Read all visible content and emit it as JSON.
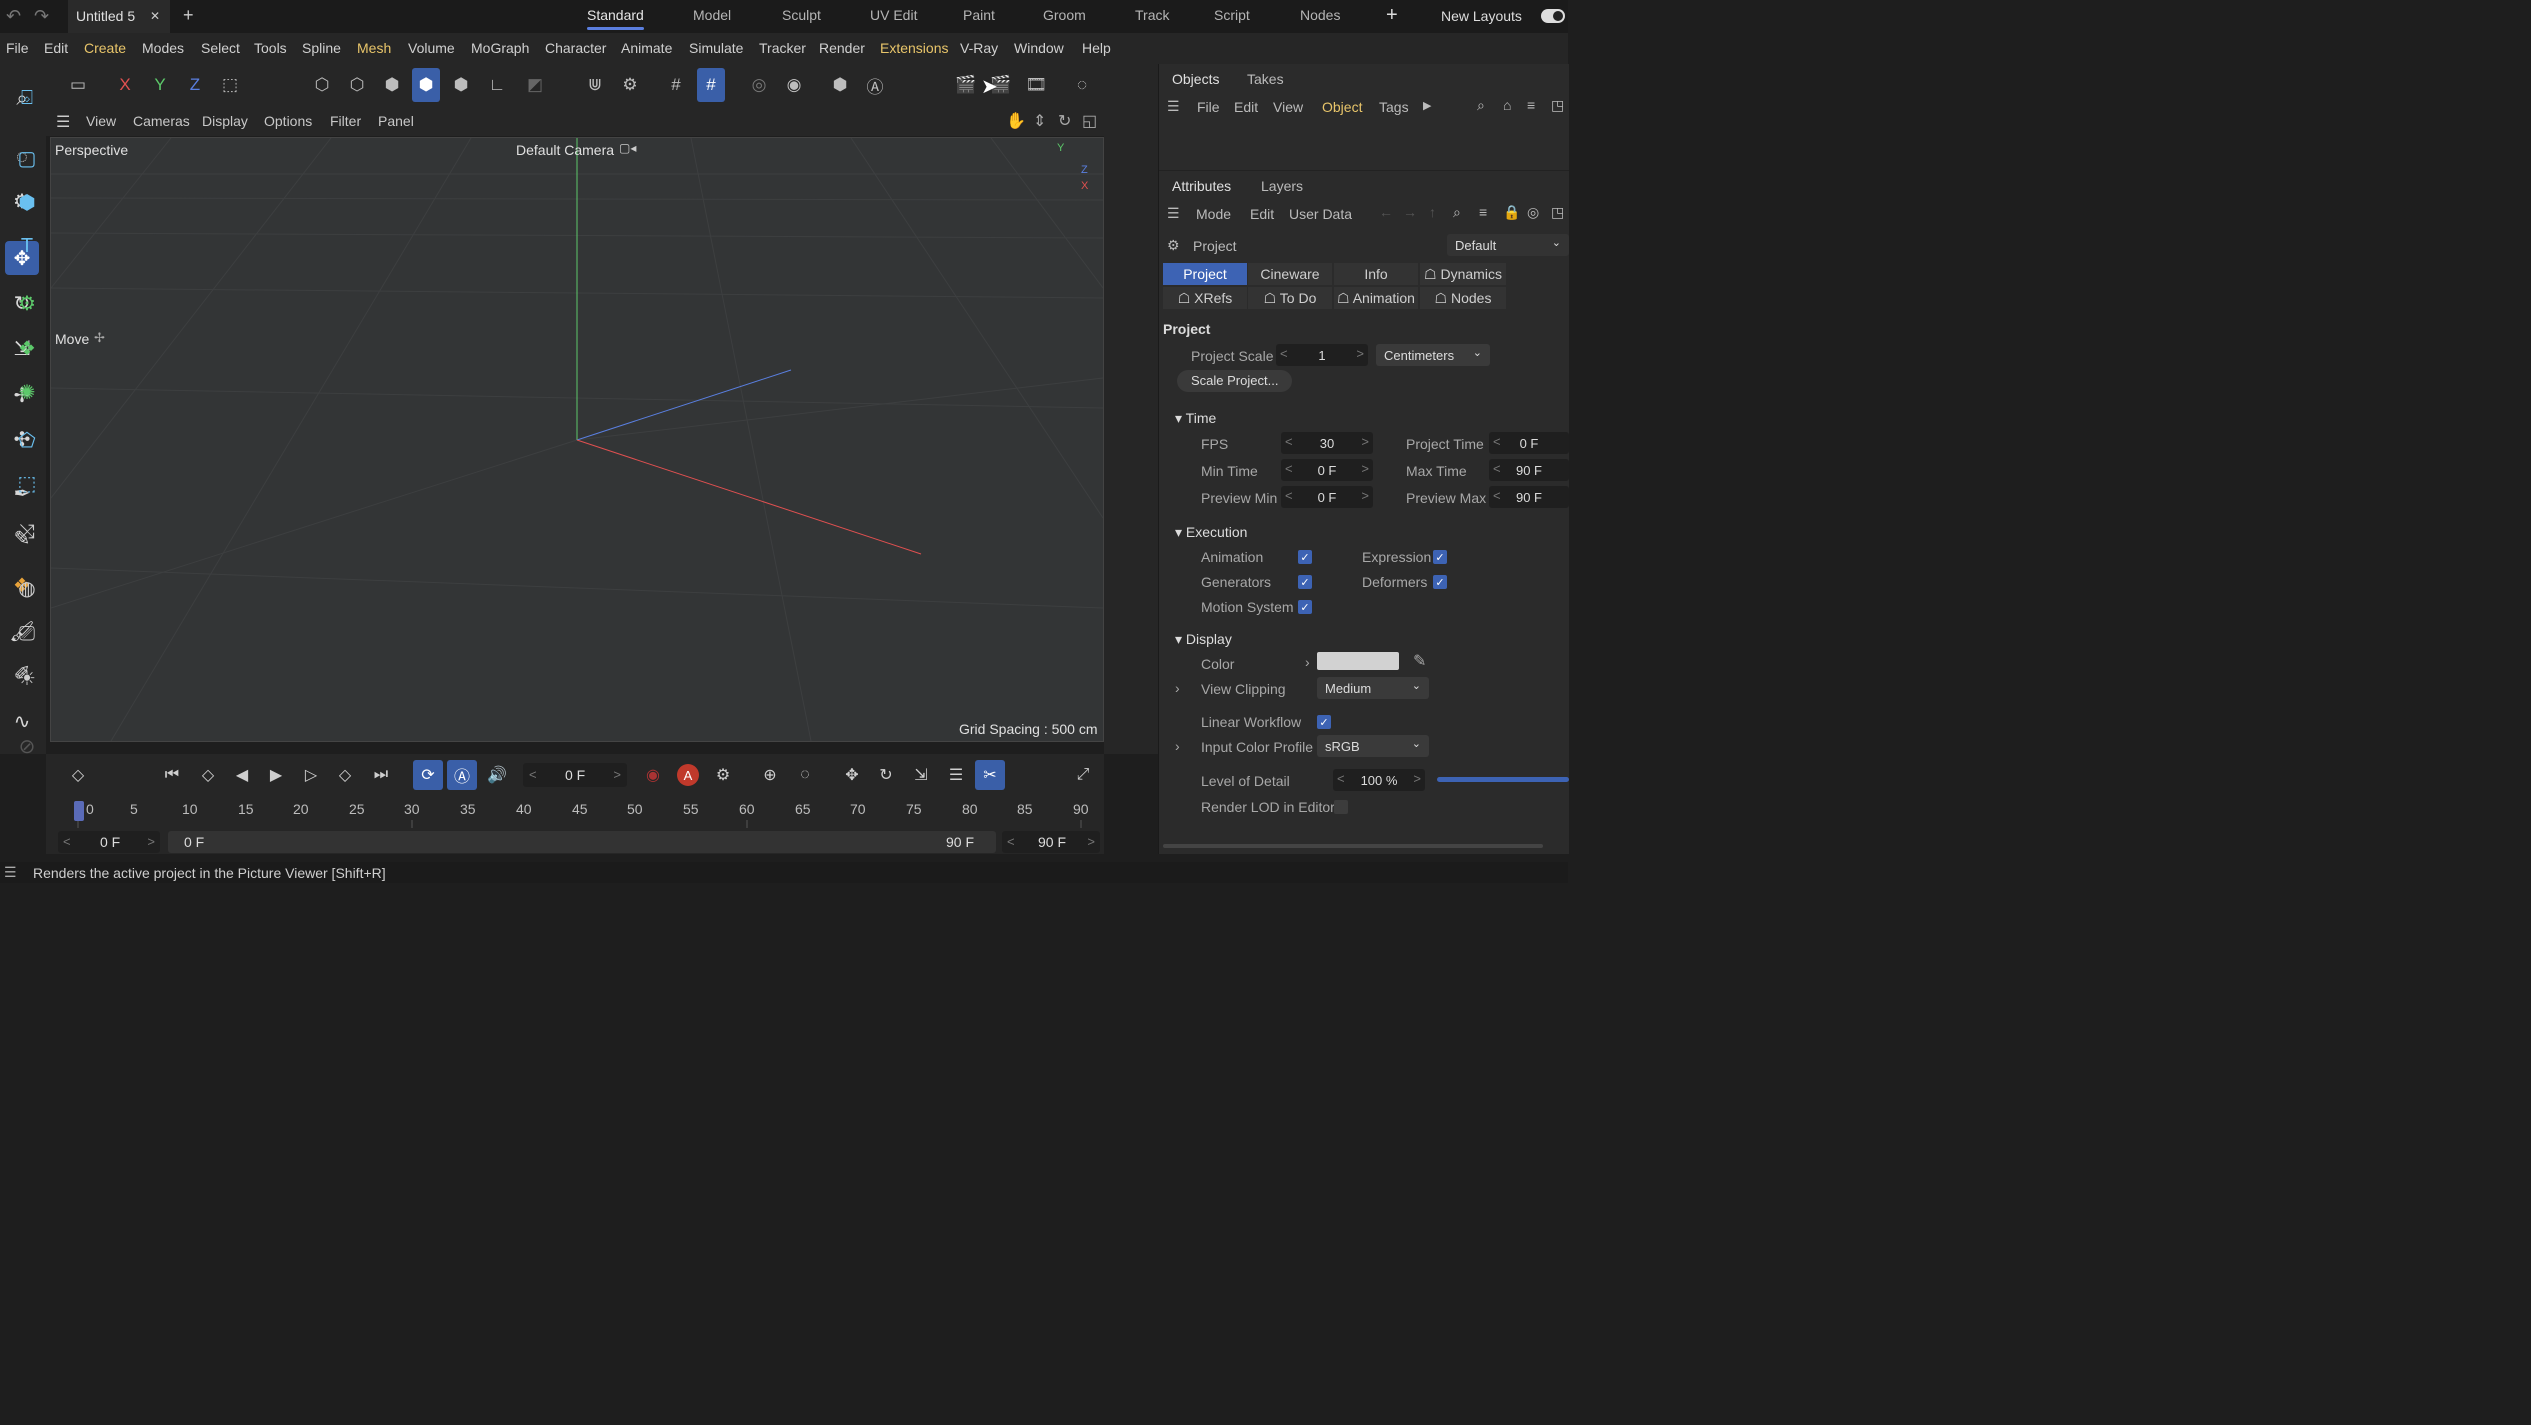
{
  "doc_tab": {
    "title": "Untitled 5",
    "close": "✕",
    "add": "+"
  },
  "layouts": [
    "Standard",
    "Model",
    "Sculpt",
    "UV Edit",
    "Paint",
    "Groom",
    "Track",
    "Script",
    "Nodes"
  ],
  "layouts_add": "+",
  "new_layouts": "New Layouts",
  "menu": [
    "File",
    "Edit",
    "Create",
    "Modes",
    "Select",
    "Tools",
    "Spline",
    "Mesh",
    "Volume",
    "MoGraph",
    "Character",
    "Animate",
    "Simulate",
    "Tracker",
    "Render",
    "Extensions",
    "V-Ray",
    "Window",
    "Help"
  ],
  "toolbar": {
    "x": "X",
    "y": "Y",
    "z": "Z"
  },
  "tool_tip_label": "Move",
  "viewport_menu": [
    "View",
    "Cameras",
    "Display",
    "Options",
    "Filter",
    "Panel"
  ],
  "viewport": {
    "view_name": "Perspective",
    "camera": "Default Camera",
    "grid_spacing": "Grid Spacing : 500 cm",
    "axis_y": "Y",
    "axis_z": "Z",
    "axis_x": "X"
  },
  "objects_panel": {
    "tabs": [
      "Objects",
      "Takes"
    ],
    "menu": [
      "File",
      "Edit",
      "View",
      "Object",
      "Tags"
    ]
  },
  "attributes_panel": {
    "tabs": [
      "Attributes",
      "Layers"
    ],
    "menu": [
      "Mode",
      "Edit",
      "User Data"
    ],
    "object": "Project",
    "preset": "Default",
    "subtabs_row1": [
      "Project",
      "Cineware",
      "Info",
      "☖ Dynamics"
    ],
    "subtabs_row2": [
      "☖ XRefs",
      "☖ To Do",
      "☖ Animation",
      "☖ Nodes"
    ],
    "section_title": "Project",
    "project_scale_label": "Project Scale",
    "project_scale_value": "1",
    "project_scale_unit": "Centimeters",
    "scale_project_button": "Scale Project...",
    "time_section": "Time",
    "fps_label": "FPS",
    "fps_value": "30",
    "project_time_label": "Project Time",
    "project_time_value": "0 F",
    "min_time_label": "Min Time",
    "min_time_value": "0 F",
    "max_time_label": "Max Time",
    "max_time_value": "90 F",
    "preview_min_label": "Preview Min",
    "preview_min_value": "0 F",
    "preview_max_label": "Preview Max",
    "preview_max_value": "90 F",
    "execution_section": "Execution",
    "animation_label": "Animation",
    "expression_label": "Expression",
    "generators_label": "Generators",
    "deformers_label": "Deformers",
    "motion_system_label": "Motion System",
    "display_section": "Display",
    "color_label": "Color",
    "view_clipping_label": "View Clipping",
    "view_clipping_value": "Medium",
    "linear_workflow_label": "Linear Workflow",
    "input_color_profile_label": "Input Color Profile",
    "input_color_profile_value": "sRGB",
    "level_of_detail_label": "Level of Detail",
    "level_of_detail_value": "100 %",
    "render_lod_label": "Render LOD in Editor"
  },
  "timeline": {
    "current_frame": "0 F",
    "ticks": [
      "0",
      "5",
      "10",
      "15",
      "20",
      "25",
      "30",
      "35",
      "40",
      "45",
      "50",
      "55",
      "60",
      "65",
      "70",
      "75",
      "80",
      "85",
      "90"
    ],
    "range_start": "0 F",
    "range_bar_start": "0 F",
    "range_bar_end": "90 F",
    "range_end": "90 F"
  },
  "status": "Renders the active project in the Picture Viewer [Shift+R]",
  "colors": {
    "accent": "#3a5fa8",
    "menu_highlight": "#e8c56a",
    "x_axis": "#e05050",
    "y_axis": "#5cc86a",
    "z_axis": "#5a7fe0"
  }
}
